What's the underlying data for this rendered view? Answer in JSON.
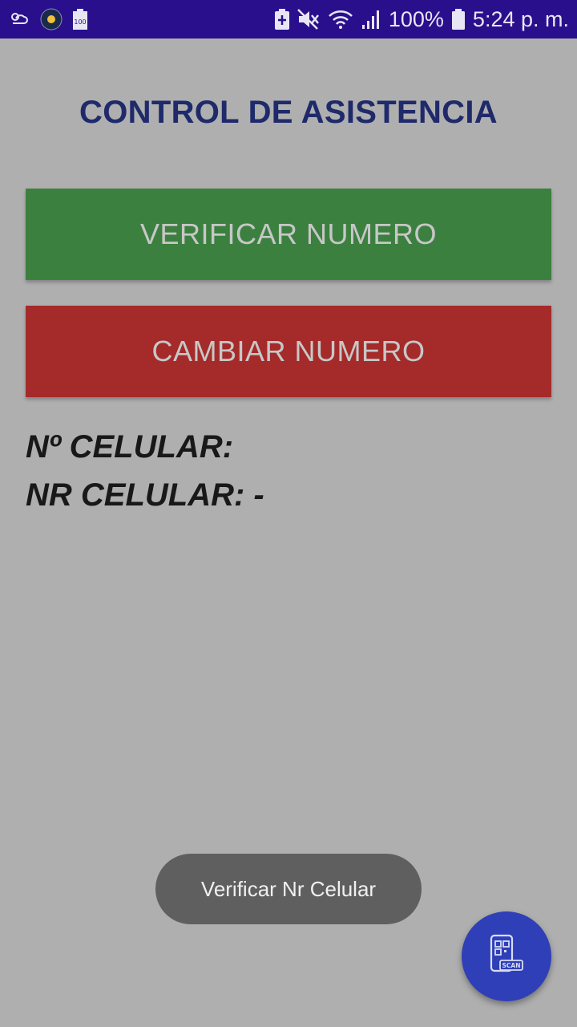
{
  "status_bar": {
    "battery_percent": "100%",
    "time": "5:24 p. m.",
    "battery_saver_badge": "100",
    "icons": [
      "cloud-sun-icon",
      "weather-icon",
      "battery-saver-icon",
      "rcs-icon",
      "mute-icon",
      "wifi-icon",
      "signal-icon",
      "battery-icon"
    ]
  },
  "screen": {
    "title": "CONTROL DE ASISTENCIA",
    "verify_button_label": "VERIFICAR NUMERO",
    "change_button_label": "CAMBIAR NUMERO",
    "cell_number_label": "Nº CELULAR:",
    "nr_cell_label": "NR CELULAR: -"
  },
  "toast": {
    "message": "Verificar Nr Celular"
  },
  "fab": {
    "icon": "scan-icon",
    "label": "SCAN"
  },
  "colors": {
    "status_bar": "#2a0f8c",
    "background": "#afafaf",
    "title": "#1f2a6b",
    "verify_button": "#3c8040",
    "change_button": "#a52a2a",
    "fab": "#2f3fb8",
    "toast": "#5f5f5f"
  }
}
